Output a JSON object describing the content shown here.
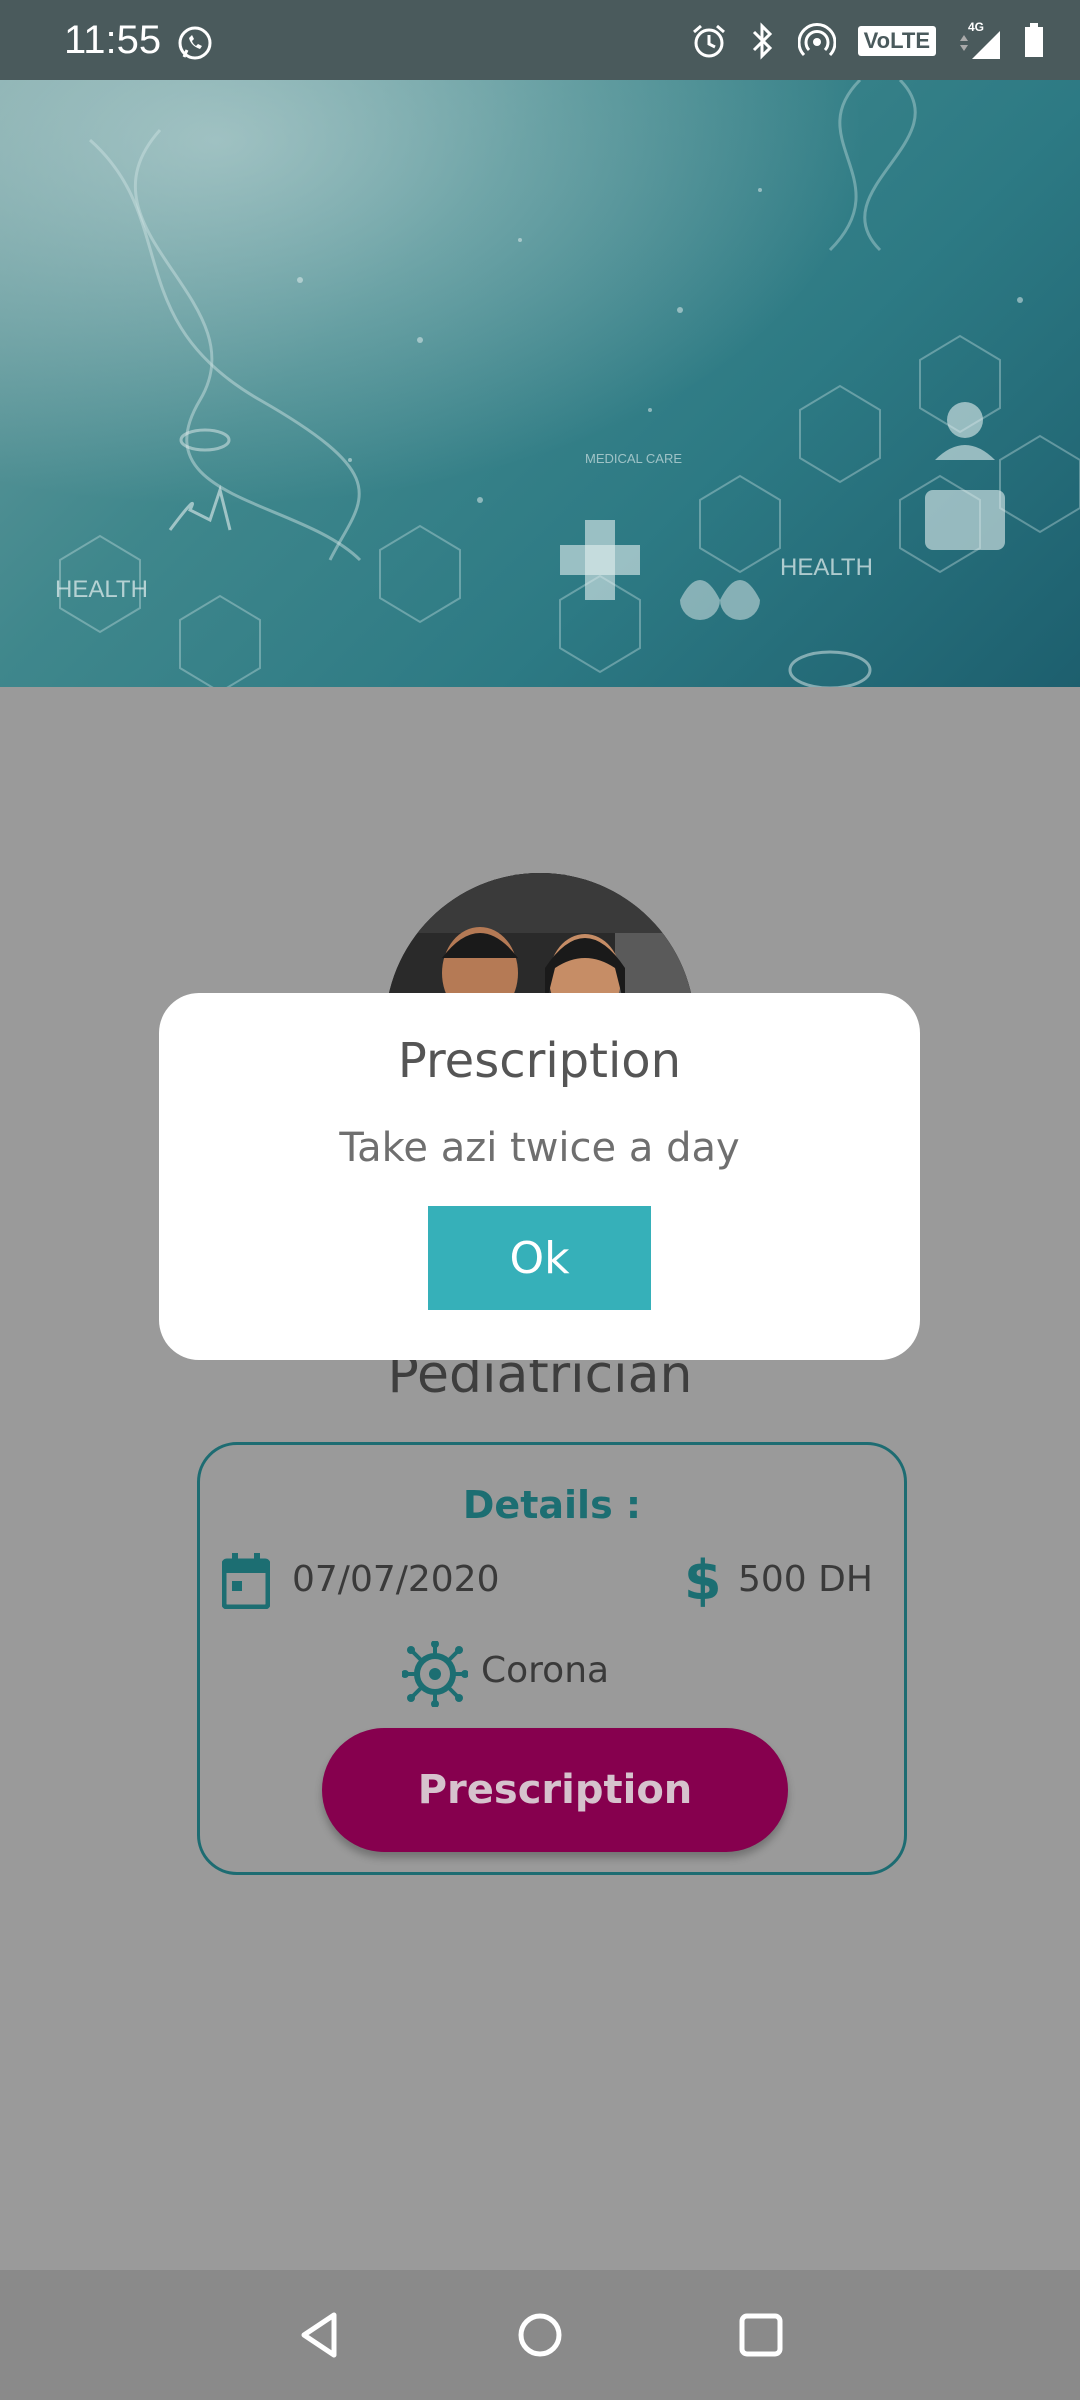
{
  "status": {
    "time": "11:55",
    "network": "4G",
    "volte": "VoLTE"
  },
  "header": {
    "image_texts": [
      "HEALTH",
      "HEALTH",
      "MEDICAL CARE"
    ]
  },
  "doctor": {
    "specialty": "Pediatrician"
  },
  "details": {
    "title": "Details :",
    "date": "07/07/2020",
    "price": "500 DH",
    "disease": "Corona",
    "prescription_button": "Prescription"
  },
  "dialog": {
    "title": "Prescription",
    "message": "Take azi twice a day",
    "ok_label": "Ok"
  },
  "colors": {
    "accent": "#36b0b9",
    "primary_dark": "#1c6e72",
    "button": "#86004e"
  },
  "icons": [
    "whatsapp-icon",
    "alarm-icon",
    "bluetooth-icon",
    "hotspot-icon",
    "signal-icon",
    "battery-icon",
    "calendar-icon",
    "dollar-icon",
    "virus-icon",
    "back-icon",
    "home-icon",
    "recents-icon"
  ]
}
